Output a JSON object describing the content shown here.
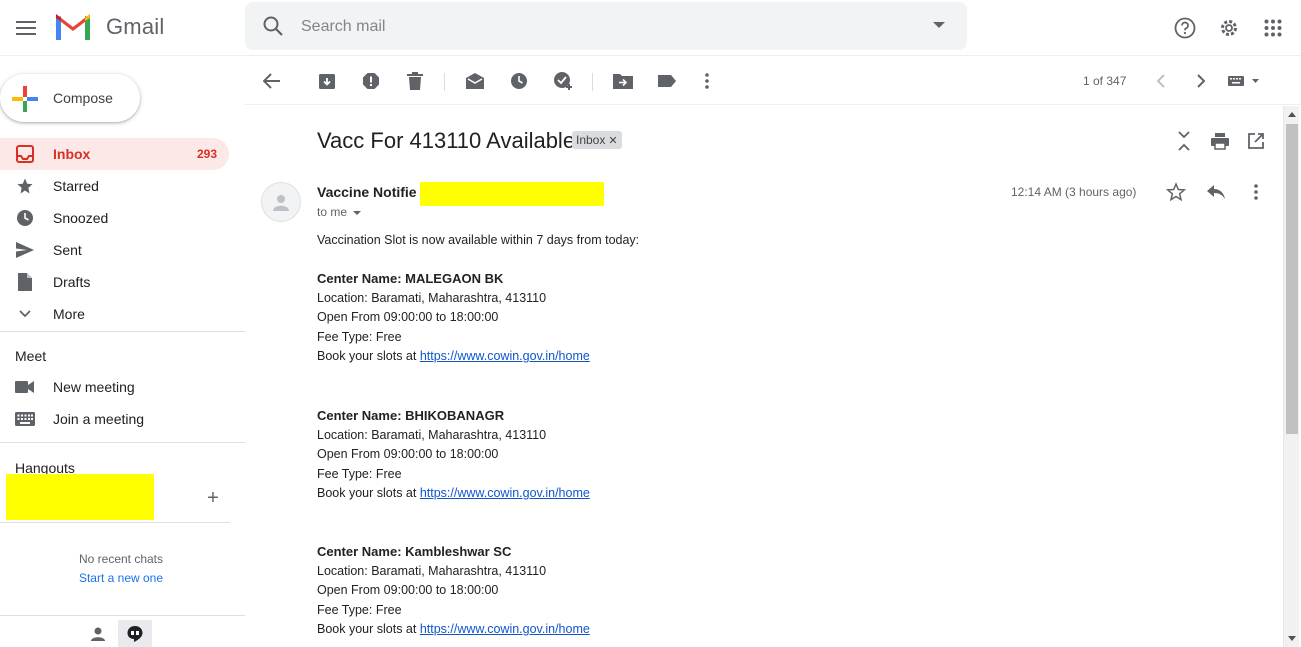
{
  "app": {
    "name": "Gmail"
  },
  "search": {
    "placeholder": "Search mail"
  },
  "sidebar": {
    "compose_label": "Compose",
    "items": [
      {
        "label": "Inbox",
        "count": "293",
        "icon": "inbox-icon"
      },
      {
        "label": "Starred",
        "icon": "star-icon"
      },
      {
        "label": "Snoozed",
        "icon": "clock-icon"
      },
      {
        "label": "Sent",
        "icon": "send-icon"
      },
      {
        "label": "Drafts",
        "icon": "draft-icon"
      },
      {
        "label": "More",
        "icon": "chevron-down-icon"
      }
    ],
    "meet": {
      "title": "Meet",
      "items": [
        {
          "label": "New meeting",
          "icon": "video-icon"
        },
        {
          "label": "Join a meeting",
          "icon": "keyboard-icon"
        }
      ]
    },
    "hangouts": {
      "title": "Hangouts",
      "no_chats": "No recent chats",
      "start_new": "Start a new one"
    }
  },
  "toolbar": {
    "pager": "1 of 347"
  },
  "message": {
    "subject": "Vacc For 413110 Available",
    "tag": "Inbox",
    "sender": "Vaccine Notifie",
    "to": "to me",
    "timestamp": "12:14 AM (3 hours ago)",
    "intro": "Vaccination Slot is now available within 7 days from today:",
    "centers": [
      {
        "name": "Center Name: MALEGAON BK",
        "location": "Location: Baramati, Maharashtra, 413110",
        "open": "Open From 09:00:00 to 18:00:00",
        "fee": "Fee Type: Free",
        "book_prefix": "Book your slots at ",
        "link": "https://www.cowin.gov.in/home"
      },
      {
        "name": "Center Name: BHIKOBANAGR",
        "location": "Location: Baramati, Maharashtra, 413110",
        "open": "Open From 09:00:00 to 18:00:00",
        "fee": "Fee Type: Free",
        "book_prefix": "Book your slots at ",
        "link": "https://www.cowin.gov.in/home"
      },
      {
        "name": "Center Name: Kambleshwar SC",
        "location": "Location: Baramati, Maharashtra, 413110",
        "open": "Open From 09:00:00 to 18:00:00",
        "fee": "Fee Type: Free",
        "book_prefix": "Book your slots at ",
        "link": "https://www.cowin.gov.in/home"
      }
    ]
  },
  "colors": {
    "accent_red": "#d93025",
    "active_bg": "#fce8e6",
    "link": "#1155cc",
    "redaction": "#ffff00"
  }
}
